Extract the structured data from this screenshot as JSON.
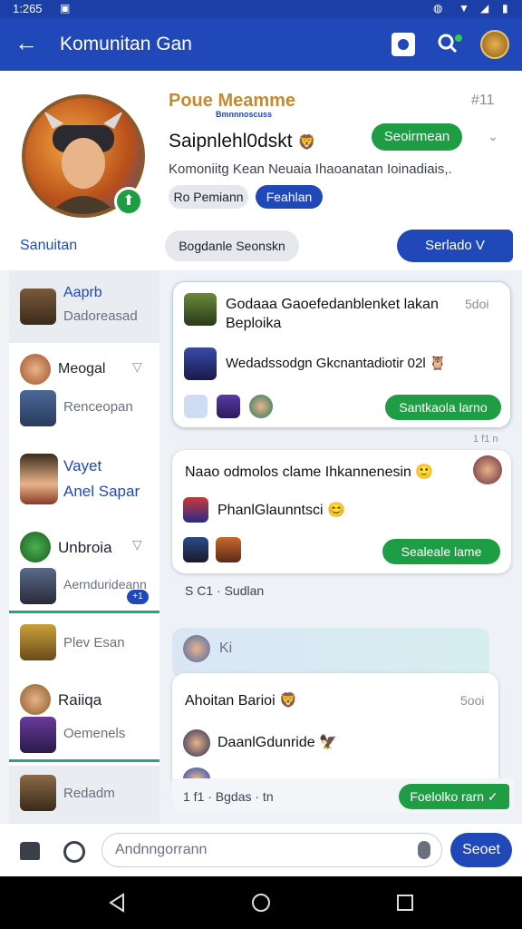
{
  "status_bar": {
    "time": "1:265"
  },
  "app_bar": {
    "title": "Komunitan Gan"
  },
  "profile": {
    "name": "Poue Meamme",
    "subtitle": "Bmnnnoscuss",
    "tag": "#11",
    "username": "Saipnlehl0dskt",
    "follow_label": "Seoirmean",
    "description": "Komoniitg Kean Neuaia Ihaoanatan Ioinadiais,.",
    "chip_grey": "Ro Pemiann",
    "chip_blue": "Feahlan"
  },
  "tabs": {
    "left": "Sanuitan",
    "middle": "Bogdanle Seonskn",
    "right": "Serlado V"
  },
  "sidebar": {
    "items": [
      {
        "line1": "Aaprb",
        "line2": "Dadoreasad"
      },
      {
        "line1": "Meogal",
        "line2": "Renceopan"
      },
      {
        "line1": "Vayet",
        "line2": "Anel Sapar"
      },
      {
        "line1": "Unbroia",
        "line2": "Aerndurideann",
        "badge": "+1"
      },
      {
        "line1": "Plev Esan"
      },
      {
        "line1": "Raiiqa",
        "line2": "Oemenels"
      },
      {
        "line1": "Redadm"
      }
    ]
  },
  "feed": {
    "card1": {
      "title": "Godaaa Gaoefedanblenket lakan Beploika",
      "time": "5doi",
      "line2": "Wedadssodgn Gkcnantadiotir 02l",
      "button": "Santkaola larno"
    },
    "separator_time": "1 f1 n",
    "card2": {
      "title": "Naao odmolos clame Ihkannenesin",
      "line2": "PhanlGlaunntsci",
      "button": "Sealeale lame"
    },
    "footer_text": "S C1 · Sudlan",
    "card3_header": "Ki",
    "card3": {
      "title": "Ahoitan Barioi",
      "time": "5ooi",
      "line2": "DaanlGdunride",
      "footer_text": "1 f1 · Bgdas · tn",
      "button": "Foelolko rarn ✓"
    }
  },
  "compose": {
    "placeholder": "Andnngorrann",
    "send_label": "Seoet"
  },
  "colors": {
    "primary": "#2148b8",
    "accent_green": "#1f9d45",
    "gold": "#c9892a"
  }
}
